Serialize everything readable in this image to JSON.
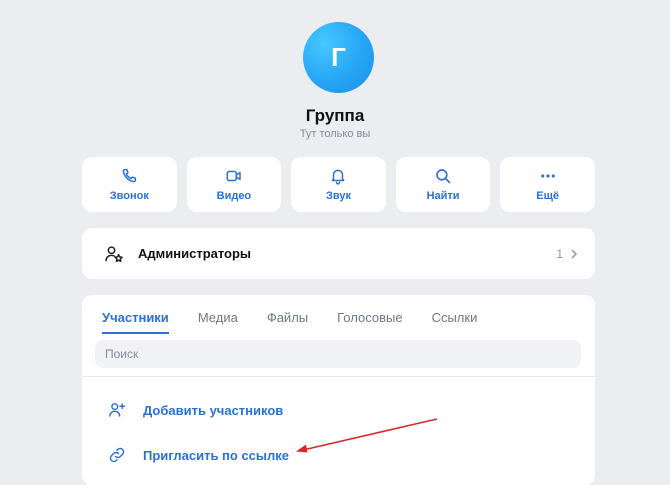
{
  "group": {
    "avatar_letter": "Г",
    "title": "Группа",
    "subtitle": "Тут только вы"
  },
  "actions": [
    {
      "label": "Звонок",
      "icon": "phone-icon"
    },
    {
      "label": "Видео",
      "icon": "video-camera-icon"
    },
    {
      "label": "Звук",
      "icon": "bell-icon"
    },
    {
      "label": "Найти",
      "icon": "search-icon"
    },
    {
      "label": "Ещё",
      "icon": "more-dots-icon"
    }
  ],
  "admins": {
    "label": "Администраторы",
    "count": "1"
  },
  "tabs": [
    {
      "label": "Участники",
      "active": true
    },
    {
      "label": "Медиа"
    },
    {
      "label": "Файлы"
    },
    {
      "label": "Голосовые"
    },
    {
      "label": "Ссылки"
    }
  ],
  "search": {
    "placeholder": "Поиск"
  },
  "member_actions": {
    "add_label": "Добавить участников",
    "invite_label": "Пригласить по ссылке"
  },
  "colors": {
    "accent": "#2a71d6",
    "background": "#ebedf0",
    "annotation_arrow": "#d62828"
  }
}
